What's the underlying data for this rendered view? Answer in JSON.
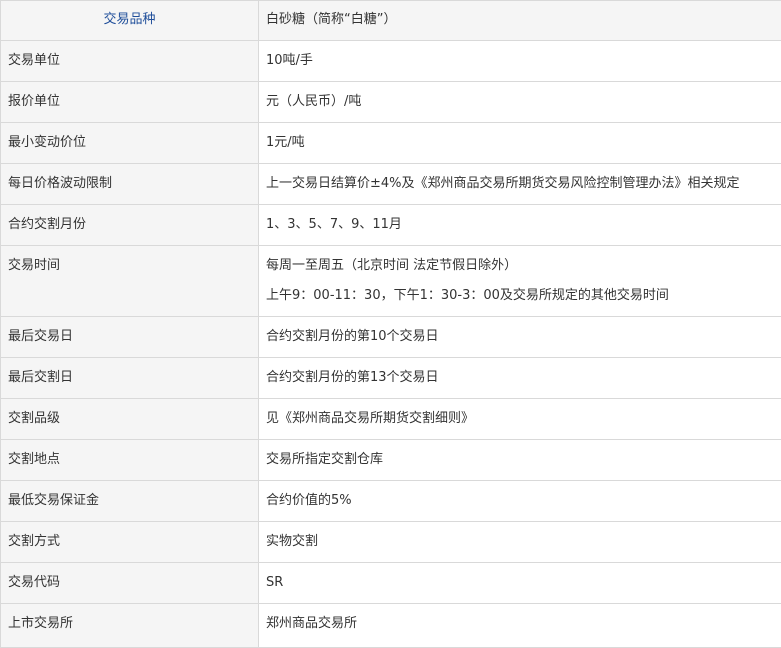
{
  "table": {
    "header": {
      "label": "交易品种",
      "value": "白砂糖（简称“白糖”）"
    },
    "rows": [
      {
        "label": "交易单位",
        "value": "10吨/手"
      },
      {
        "label": "报价单位",
        "value": "元（人民币）/吨"
      },
      {
        "label": "最小变动价位",
        "value": "1元/吨"
      },
      {
        "label": "每日价格波动限制",
        "value": "上一交易日结算价±4%及《郑州商品交易所期货交易风险控制管理办法》相关规定"
      },
      {
        "label": "合约交割月份",
        "value": "1、3、5、7、9、11月"
      },
      {
        "label": "交易时间",
        "value": "每周一至周五（北京时间 法定节假日除外）",
        "value_line2": "上午9：00-11：30，下午1：30-3：00及交易所规定的其他交易时间"
      },
      {
        "label": "最后交易日",
        "value": "合约交割月份的第10个交易日"
      },
      {
        "label": "最后交割日",
        "value": "合约交割月份的第13个交易日"
      },
      {
        "label": "交割品级",
        "value": "见《郑州商品交易所期货交割细则》"
      },
      {
        "label": "交割地点",
        "value": "交易所指定交割仓库"
      },
      {
        "label": "最低交易保证金",
        "value": "合约价值的5%"
      },
      {
        "label": "交割方式",
        "value": "实物交割"
      },
      {
        "label": "交易代码",
        "value": "SR"
      },
      {
        "label": "上市交易所",
        "value": "郑州商品交易所"
      }
    ]
  }
}
